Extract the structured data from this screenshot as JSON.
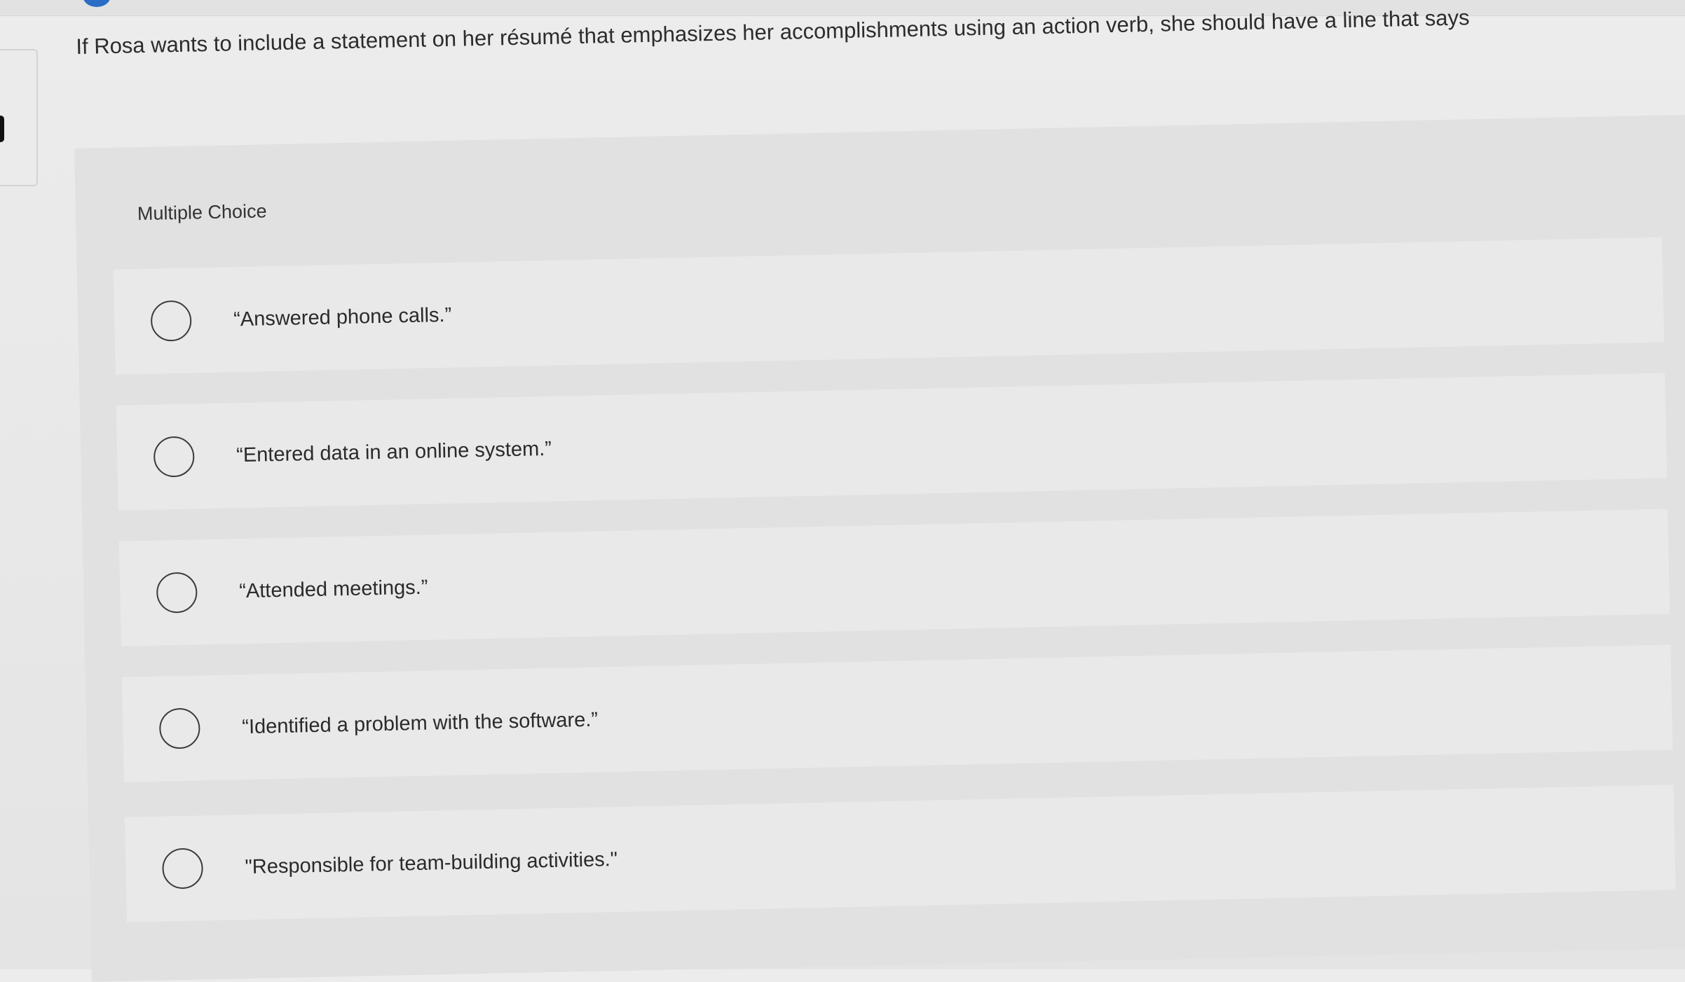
{
  "question": {
    "text": "If Rosa wants to include a statement on her résumé that emphasizes her accomplishments using an action verb, she should have a line that says"
  },
  "panel": {
    "label": "Multiple Choice"
  },
  "choices": [
    {
      "text": "“Answered phone calls.”"
    },
    {
      "text": "“Entered data in an online system.”"
    },
    {
      "text": "“Attended meetings.”"
    },
    {
      "text": "“Identified a problem with the software.”"
    },
    {
      "text": "\"Responsible for team-building activities.\""
    }
  ],
  "colors": {
    "background": "#ebebeb",
    "panel": "#e1e1e1",
    "choice_row": "#e9e9e9",
    "radio_border": "#3b3b3b",
    "accent_badge": "#2a6dc7"
  }
}
